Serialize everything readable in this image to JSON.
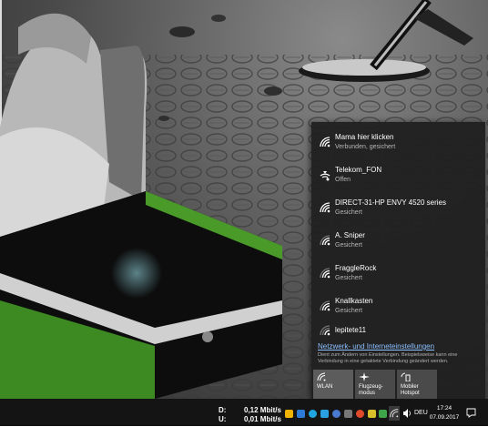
{
  "wifi_flyout": {
    "networks": [
      {
        "name": "Mama hier klicken",
        "status": "Verbunden, gesichert",
        "icon": "wifi-icon"
      },
      {
        "name": "Telekom_FON",
        "status": "Offen",
        "icon": "wifi-open-icon"
      },
      {
        "name": "DIRECT-31-HP ENVY 4520 series",
        "status": "Gesichert",
        "icon": "wifi-icon"
      },
      {
        "name": "A. Sniper",
        "status": "Gesichert",
        "icon": "wifi-icon"
      },
      {
        "name": "FraggleRock",
        "status": "Gesichert",
        "icon": "wifi-icon"
      },
      {
        "name": "Knallkasten",
        "status": "Gesichert",
        "icon": "wifi-icon"
      },
      {
        "name": "lepitete11",
        "status": "",
        "icon": "wifi-icon"
      }
    ],
    "settings_link": "Netzwerk- und Interneteinstellungen",
    "settings_description": "Dient zum Ändern von Einstellungen. Beispielsweise kann eine Verbindung in eine getaktete Verbindung geändert werden.",
    "quick_actions": [
      {
        "label": "WLAN",
        "icon": "wifi-icon",
        "active": true
      },
      {
        "label": "Flugzeug-\nmodus",
        "icon": "airplane-icon",
        "active": false
      },
      {
        "label": "Mobiler\nHotspot",
        "icon": "hotspot-icon",
        "active": false
      }
    ]
  },
  "taskbar": {
    "download_label": "D:",
    "download_value": "0,12 Mbit/s",
    "upload_label": "U:",
    "upload_value": "0,01 Mbit/s",
    "language": "DEU",
    "time": "17:24",
    "date": "07.09.2017",
    "tray_icon_colors": [
      "#f0b400",
      "#2e7bd6",
      "#1fa5e0",
      "#2aa0e0",
      "#e04a2a",
      "#d8c02a",
      "#3fa54a",
      "#2e7bd6"
    ]
  },
  "colors": {
    "flyout_bg": "#202020",
    "link": "#8cc0ff",
    "taskbar": "#141414"
  }
}
